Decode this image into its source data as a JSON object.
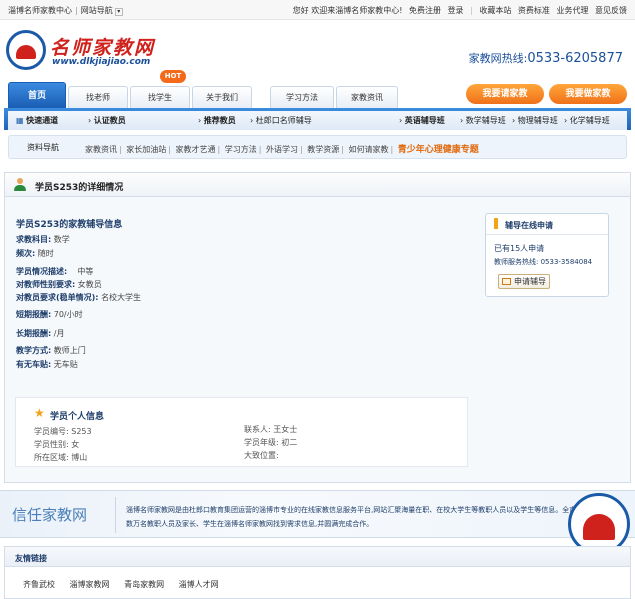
{
  "topbar": {
    "site_name": "淄博名师家教中心",
    "site_nav": "网站导航",
    "welcome": "您好 欢迎来淄博名师家教中心!",
    "register": "免费注册",
    "login": "登录",
    "favorite": "收藏本站",
    "standard": "资费标准",
    "agent": "业务代理",
    "feedback": "意见反馈"
  },
  "logo": {
    "name": "名师家教网",
    "url": "www.dlkjiajiao.com"
  },
  "hotline": {
    "label": "家教网热线:",
    "number": "0533-6205877"
  },
  "nav": {
    "tabs": [
      "首页",
      "找老师",
      "找学生",
      "关于我们",
      "学习方法",
      "家教资讯"
    ],
    "hot_badge": "HOT",
    "btn_request": "我要请家教",
    "btn_teach": "我要做家教"
  },
  "catbar": {
    "fast": "快速通道",
    "certified": "认证教员",
    "recommended": "推荐教员",
    "duxiangkou": "杜郎口名师辅导",
    "english": "英语辅导班",
    "math": "数学辅导班",
    "physics": "物理辅导班",
    "chemistry": "化学辅导班"
  },
  "subnav": {
    "title": "资料导航",
    "links": [
      "家教资讯",
      "家长加油站",
      "家教才艺通",
      "学习方法",
      "外语学习",
      "教学资源",
      "如何请家教"
    ],
    "highlight": "青少年心理健康专题"
  },
  "section": {
    "title": "学员S253的详细情况"
  },
  "detail": {
    "heading": "学员S253的家教辅导信息",
    "subject_k": "求教科目:",
    "subject_v": "数学",
    "freq_k": "频次:",
    "freq_v": "随时",
    "status_k": "学员情况描述:",
    "status_v": "中等",
    "gender_k": "对教师性别要求:",
    "gender_v": "女教员",
    "req_k": "对教员要求(稳单情况):",
    "req_v": "名校大学生",
    "short_k": "短期报酬:",
    "short_v": "70/小时",
    "long_k": "长期报酬:",
    "long_v": "/月",
    "mode_k": "教学方式:",
    "mode_v": "教师上门",
    "car_k": "有无车贴:",
    "car_v": "无车贴"
  },
  "apply": {
    "title": "辅导在线申请",
    "count": "已有15人申请",
    "phone": "教师服务热线: 0533-3584084",
    "button": "申请辅导"
  },
  "personal": {
    "title": "学员个人信息",
    "id": "学员编号: S253",
    "gender": "学员性别: 女",
    "area": "所在区域: 博山",
    "contact": "联系人: 王女士",
    "grade": "学员年级: 初二",
    "location": "大致位置:"
  },
  "trust": {
    "brand": "信任家教网",
    "desc": "淄博名师家教网是由杜郎口教育集团运营的淄博市专业的在线家教信息服务平台,网站汇聚海量在职、在校大学生等教职人员以及学生等信息。全市已有数万名教职人员及家长、学生在淄博名师家教网找到需求信息,并圆满完成合作。"
  },
  "friends": {
    "title": "友情链接",
    "links": [
      "齐鲁武校",
      "淄博家教网",
      "青岛家教网",
      "淄博人才网"
    ]
  }
}
